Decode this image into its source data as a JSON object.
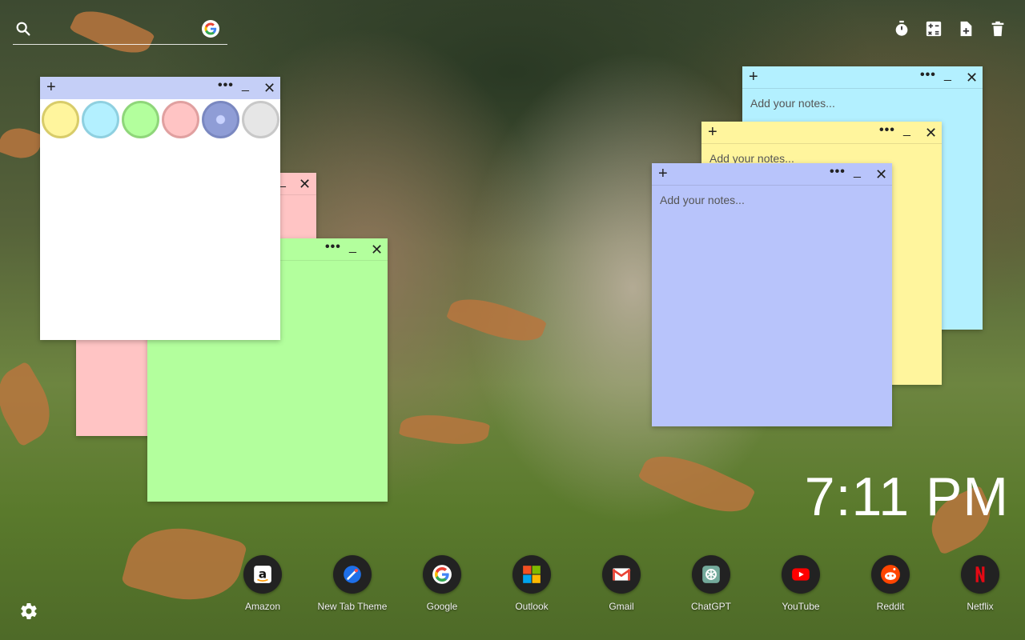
{
  "search": {
    "placeholder": ""
  },
  "tools": [
    {
      "icon": "timer-icon"
    },
    {
      "icon": "calculator-icon"
    },
    {
      "icon": "new-note-icon"
    },
    {
      "icon": "trash-icon"
    }
  ],
  "notes": {
    "palette": {
      "swatches": [
        {
          "color": "#fff59d",
          "border": "#d8cc6a"
        },
        {
          "color": "#b3f0ff",
          "border": "#8fd0e0"
        },
        {
          "color": "#b3ff9d",
          "border": "#8fd67a"
        },
        {
          "color": "#ffc4c4",
          "border": "#e0a0a0"
        },
        {
          "color": "#8f9dd6",
          "border": "#7a88c0"
        },
        {
          "color": "#e6e6e6",
          "border": "#c8c8c8"
        }
      ]
    },
    "cyan": {
      "placeholder": "Add your notes..."
    },
    "yellow": {
      "placeholder": "Add your notes..."
    },
    "blue": {
      "placeholder": "Add your notes..."
    },
    "controls": {
      "plus": "+",
      "more": "•••",
      "min": "_",
      "close": "✕"
    }
  },
  "clock": {
    "time": "7:11 PM"
  },
  "dock": {
    "apps": [
      {
        "label": "Amazon"
      },
      {
        "label": "New Tab Theme"
      },
      {
        "label": "Google"
      },
      {
        "label": "Outlook"
      },
      {
        "label": "Gmail"
      },
      {
        "label": "ChatGPT"
      },
      {
        "label": "YouTube"
      },
      {
        "label": "Reddit"
      },
      {
        "label": "Netflix"
      }
    ]
  },
  "colors": {
    "note_white": "#ffffff",
    "note_white_bar": "#c5cff7",
    "note_pink": "#ffc4c4",
    "note_green": "#b3ff9d",
    "note_cyan": "#b3f0ff",
    "note_yellow": "#fff59d",
    "note_blue": "#b8c4fb"
  }
}
